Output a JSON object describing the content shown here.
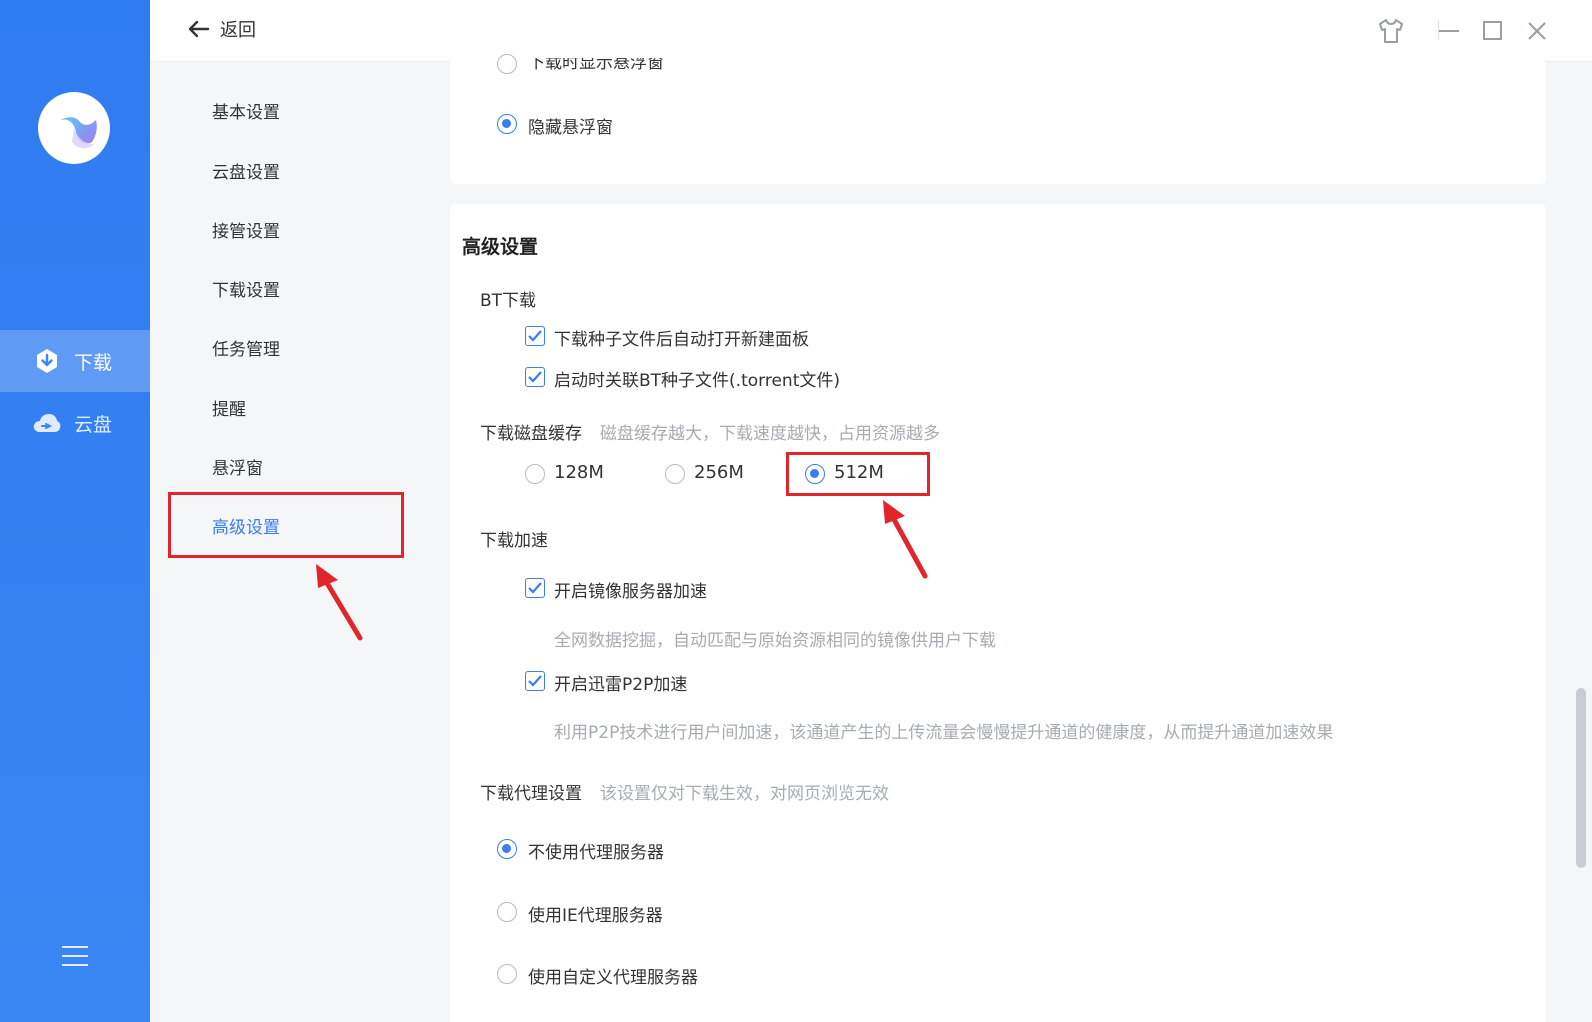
{
  "topbar": {
    "back_label": "返回"
  },
  "rail": {
    "items": [
      {
        "label": "下载",
        "icon": "download-icon",
        "active": true
      },
      {
        "label": "云盘",
        "icon": "cloud-icon",
        "active": false
      }
    ]
  },
  "subnav": {
    "items": [
      {
        "label": "基本设置"
      },
      {
        "label": "云盘设置"
      },
      {
        "label": "接管设置"
      },
      {
        "label": "下载设置"
      },
      {
        "label": "任务管理"
      },
      {
        "label": "提醒"
      },
      {
        "label": "悬浮窗"
      },
      {
        "label": "高级设置",
        "active": true
      }
    ]
  },
  "float_window": {
    "partial_option": "下载时显示悬浮窗",
    "hide_option": "隐藏悬浮窗"
  },
  "advanced": {
    "title": "高级设置",
    "bt": {
      "label": "BT下载",
      "opt1": "下载种子文件后自动打开新建面板",
      "opt2": "启动时关联BT种子文件(.torrent文件)"
    },
    "cache": {
      "label": "下载磁盘缓存",
      "hint": "磁盘缓存越大，下载速度越快，占用资源越多",
      "options": [
        "128M",
        "256M",
        "512M"
      ],
      "selected": "512M"
    },
    "accel": {
      "label": "下载加速",
      "mirror": "开启镜像服务器加速",
      "mirror_desc": "全网数据挖掘，自动匹配与原始资源相同的镜像供用户下载",
      "p2p": "开启迅雷P2P加速",
      "p2p_desc": "利用P2P技术进行用户间加速，该通道产生的上传流量会慢慢提升通道的健康度，从而提升通道加速效果"
    },
    "proxy": {
      "label": "下载代理设置",
      "hint": "该设置仅对下载生效，对网页浏览无效",
      "options": [
        "不使用代理服务器",
        "使用IE代理服务器",
        "使用自定义代理服务器"
      ],
      "selected": "不使用代理服务器"
    }
  },
  "colors": {
    "accent": "#3b7df0",
    "rail": "#2f7bf0",
    "highlight": "#e0262b"
  }
}
